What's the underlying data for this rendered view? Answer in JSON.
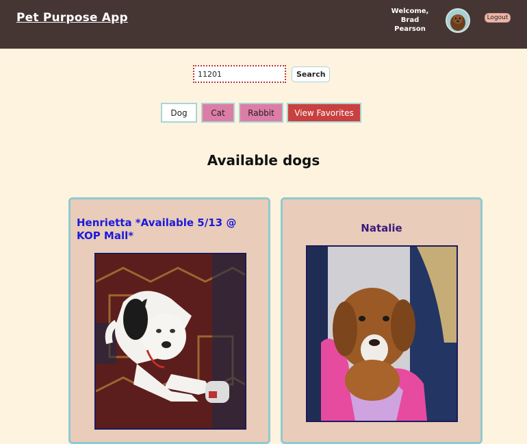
{
  "header": {
    "app_title": "Pet Purpose App",
    "welcome_line1": "Welcome,",
    "welcome_line2": "Brad",
    "welcome_line3": "Pearson",
    "logout_label": "Logout"
  },
  "search": {
    "value": "11201",
    "button_label": "Search"
  },
  "filters": {
    "dog": "Dog",
    "cat": "Cat",
    "rabbit": "Rabbit",
    "favorites": "View Favorites"
  },
  "section_title": "Available dogs",
  "pets": [
    {
      "name": "Henrietta *Available 5/13 @ KOP Mall*"
    },
    {
      "name": "Natalie"
    }
  ],
  "colors": {
    "header_bg": "#453634",
    "page_bg": "#fdf3de",
    "card_bg": "#e9ccba",
    "card_border": "#8fcad0",
    "filter_pink": "#dc7da5",
    "favorites_red": "#c94040"
  }
}
